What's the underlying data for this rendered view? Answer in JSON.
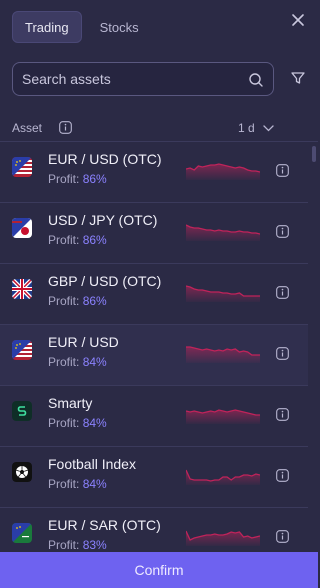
{
  "header": {
    "tabs": [
      {
        "label": "Trading",
        "active": true
      },
      {
        "label": "Stocks",
        "active": false
      }
    ],
    "close_icon": "close-icon"
  },
  "search": {
    "placeholder": "Search assets",
    "value": ""
  },
  "list_header": {
    "asset_label": "Asset",
    "period_label": "1 d"
  },
  "colors": {
    "accent": "#6e62f0",
    "profit_value": "#8b82ff",
    "sparkline": "#c0235a",
    "background": "#2b2a45"
  },
  "assets": [
    {
      "name": "EUR / USD (OTC)",
      "profit_label": "Profit:",
      "profit": "86%",
      "flag": "eu-us-flag-icon",
      "selected": false,
      "trend": [
        11,
        10,
        12,
        8,
        9,
        8,
        7,
        7,
        6,
        7,
        8,
        9,
        10,
        9,
        10,
        12,
        13,
        13,
        14
      ]
    },
    {
      "name": "USD / JPY (OTC)",
      "profit_label": "Profit:",
      "profit": "86%",
      "flag": "us-jp-flag-icon",
      "selected": false,
      "trend": [
        6,
        8,
        9,
        9,
        10,
        11,
        11,
        12,
        11,
        12,
        12,
        13,
        13,
        12,
        13,
        13,
        14,
        14,
        15
      ]
    },
    {
      "name": "GBP / USD (OTC)",
      "profit_label": "Profit:",
      "profit": "86%",
      "flag": "gb-us-flag-icon",
      "selected": false,
      "trend": [
        6,
        7,
        9,
        10,
        10,
        11,
        12,
        12,
        12,
        13,
        13,
        14,
        14,
        13,
        16,
        16,
        16,
        16,
        16
      ]
    },
    {
      "name": "EUR / USD",
      "profit_label": "Profit:",
      "profit": "84%",
      "flag": "eu-us-flag-icon",
      "selected": true,
      "trend": [
        6,
        6,
        7,
        8,
        9,
        8,
        9,
        10,
        9,
        10,
        8,
        9,
        8,
        11,
        10,
        11,
        14,
        14,
        14
      ]
    },
    {
      "name": "Smarty",
      "profit_label": "Profit:",
      "profit": "84%",
      "flag": "smarty-logo-icon",
      "selected": false,
      "trend": [
        9,
        10,
        9,
        10,
        11,
        10,
        9,
        10,
        8,
        9,
        10,
        9,
        8,
        9,
        10,
        11,
        12,
        13,
        13
      ]
    },
    {
      "name": "Football Index",
      "profit_label": "Profit:",
      "profit": "84%",
      "flag": "football-icon",
      "selected": false,
      "trend": [
        7,
        16,
        17,
        17,
        17,
        17,
        18,
        17,
        17,
        14,
        14,
        17,
        14,
        14,
        12,
        12,
        13,
        11,
        12
      ]
    },
    {
      "name": "EUR / SAR (OTC)",
      "profit_label": "Profit:",
      "profit": "83%",
      "flag": "eu-sa-flag-icon",
      "selected": false,
      "trend": [
        7,
        16,
        14,
        13,
        12,
        11,
        11,
        10,
        11,
        11,
        10,
        8,
        9,
        8,
        13,
        12,
        14,
        13,
        12
      ]
    }
  ],
  "confirm_label": "Confirm"
}
